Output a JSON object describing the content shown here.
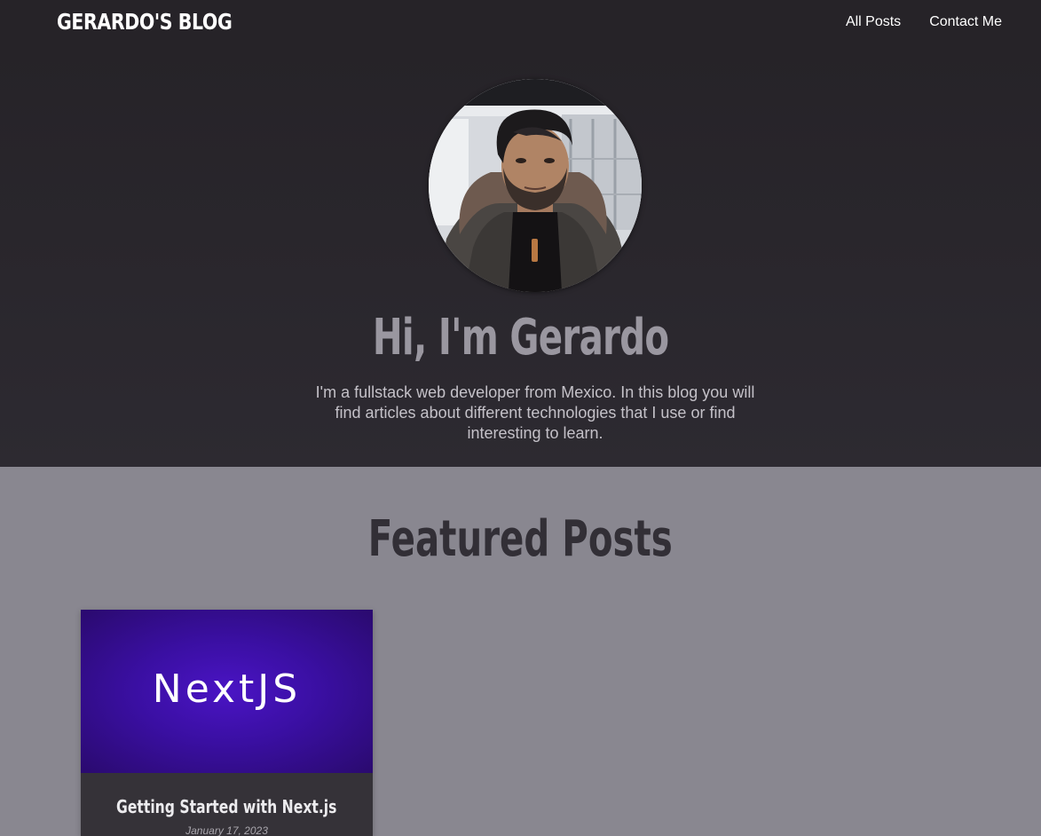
{
  "header": {
    "logo": "GERARDO'S BLOG",
    "nav": [
      {
        "label": "All Posts"
      },
      {
        "label": "Contact Me"
      }
    ]
  },
  "hero": {
    "title": "Hi, I'm Gerardo",
    "text": "I'm a fullstack web developer from Mexico. In this blog you will find articles about different technologies that I use or find interesting to learn."
  },
  "featured": {
    "title": "Featured Posts",
    "posts": [
      {
        "image_text": "NextJS",
        "title": "Getting Started with Next.js",
        "date": "January 17, 2023"
      }
    ]
  },
  "colors": {
    "header_bg": "#262328",
    "page_bg": "#898790",
    "card_bg": "#353238",
    "thumb_purple": "#4a14c4"
  }
}
